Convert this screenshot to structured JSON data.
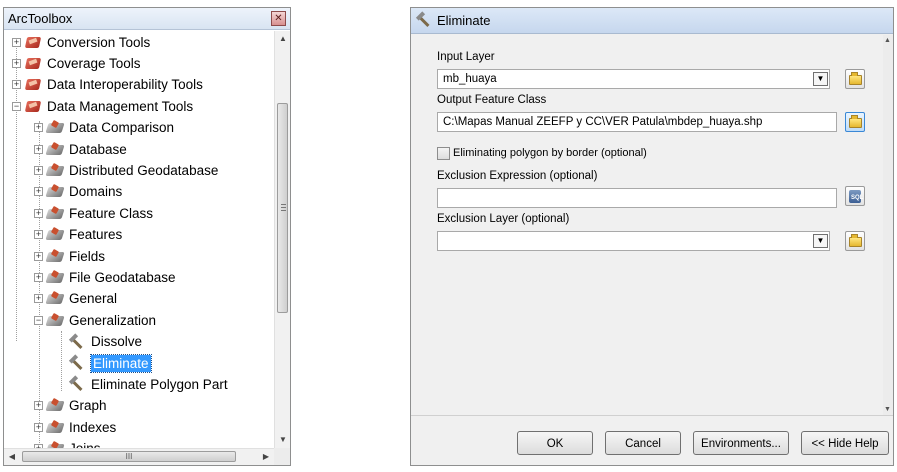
{
  "toolbox": {
    "title": "ArcToolbox",
    "close_glyph": "✕",
    "tree": [
      {
        "label": "Conversion Tools",
        "kind": "toolbox",
        "level": 0,
        "expander": "+"
      },
      {
        "label": "Coverage Tools",
        "kind": "toolbox",
        "level": 0,
        "expander": "+"
      },
      {
        "label": "Data Interoperability Tools",
        "kind": "toolbox",
        "level": 0,
        "expander": "+"
      },
      {
        "label": "Data Management Tools",
        "kind": "toolbox",
        "level": 0,
        "expander": "−"
      },
      {
        "label": "Data Comparison",
        "kind": "toolset",
        "level": 1,
        "expander": "+"
      },
      {
        "label": "Database",
        "kind": "toolset",
        "level": 1,
        "expander": "+"
      },
      {
        "label": "Distributed Geodatabase",
        "kind": "toolset",
        "level": 1,
        "expander": "+"
      },
      {
        "label": "Domains",
        "kind": "toolset",
        "level": 1,
        "expander": "+"
      },
      {
        "label": "Feature Class",
        "kind": "toolset",
        "level": 1,
        "expander": "+"
      },
      {
        "label": "Features",
        "kind": "toolset",
        "level": 1,
        "expander": "+"
      },
      {
        "label": "Fields",
        "kind": "toolset",
        "level": 1,
        "expander": "+"
      },
      {
        "label": "File Geodatabase",
        "kind": "toolset",
        "level": 1,
        "expander": "+"
      },
      {
        "label": "General",
        "kind": "toolset",
        "level": 1,
        "expander": "+"
      },
      {
        "label": "Generalization",
        "kind": "toolset",
        "level": 1,
        "expander": "−"
      },
      {
        "label": "Dissolve",
        "kind": "tool",
        "level": 2
      },
      {
        "label": "Eliminate",
        "kind": "tool",
        "level": 2,
        "selected": true
      },
      {
        "label": "Eliminate Polygon Part",
        "kind": "tool",
        "level": 2
      },
      {
        "label": "Graph",
        "kind": "toolset",
        "level": 1,
        "expander": "+"
      },
      {
        "label": "Indexes",
        "kind": "toolset",
        "level": 1,
        "expander": "+"
      },
      {
        "label": "Joins",
        "kind": "toolset",
        "level": 1,
        "expander": "+"
      }
    ],
    "hscroll_thumb_text": "III"
  },
  "dialog": {
    "title": "Eliminate",
    "input_layer": {
      "label": "Input Layer",
      "value": "mb_huaya"
    },
    "output_feature_class": {
      "label": "Output Feature Class",
      "value": "C:\\Mapas Manual ZEEFP y CC\\VER Patula\\mbdep_huaya.shp"
    },
    "eliminate_border": {
      "label": "Eliminating polygon by border (optional)",
      "checked": false
    },
    "exclusion_expression": {
      "label": "Exclusion Expression (optional)",
      "value": ""
    },
    "exclusion_layer": {
      "label": "Exclusion Layer (optional)",
      "value": ""
    },
    "sql_label": "SQL",
    "buttons": {
      "ok": "OK",
      "cancel": "Cancel",
      "environments": "Environments...",
      "hide_help": "<< Hide Help"
    }
  }
}
